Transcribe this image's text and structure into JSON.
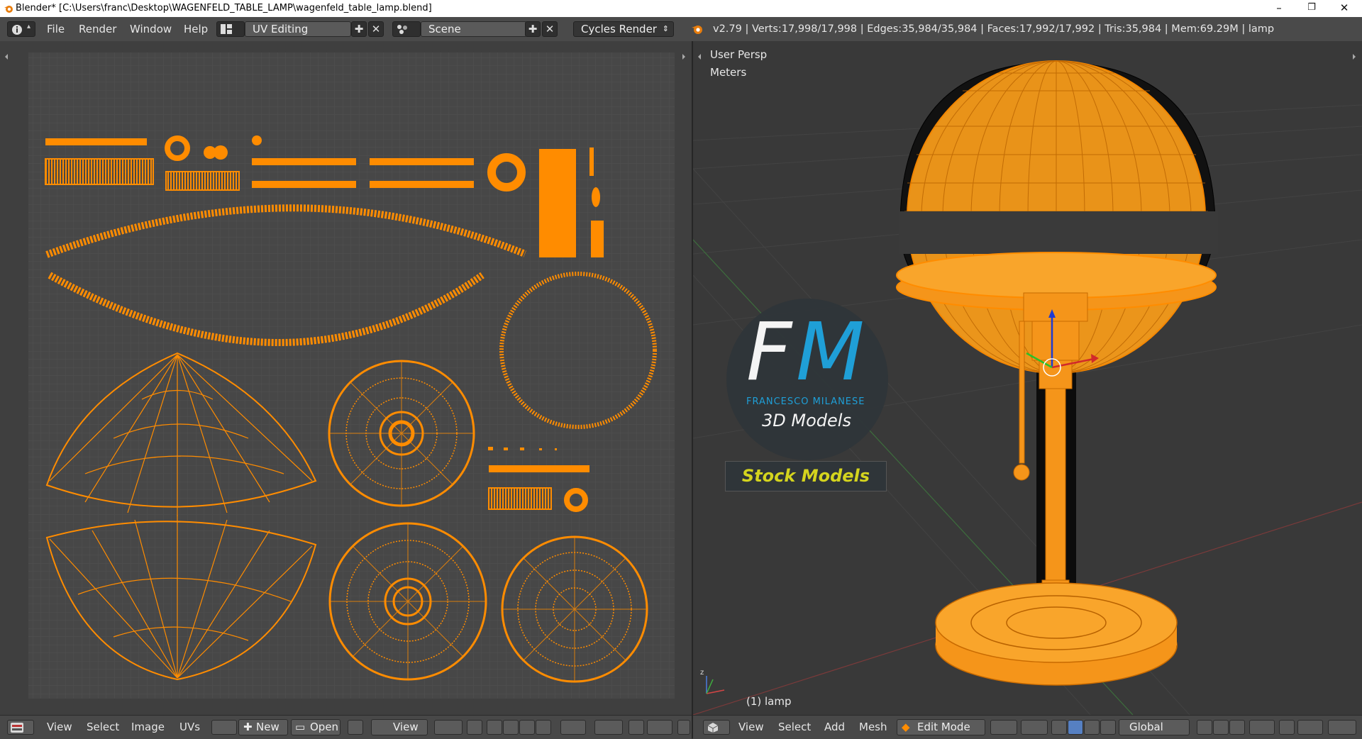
{
  "window": {
    "title": "Blender* [C:\\Users\\franc\\Desktop\\WAGENFELD_TABLE_LAMP\\wagenfeld_table_lamp.blend]",
    "minimize": "–",
    "restore": "❐",
    "close": "✕"
  },
  "topbar": {
    "menus": [
      "File",
      "Render",
      "Window",
      "Help"
    ],
    "screen_layout": "UV Editing",
    "scene": "Scene",
    "render_engine": "Cycles Render",
    "stats": "v2.79 | Verts:17,998/17,998 | Edges:35,984/35,984 | Faces:17,992/17,992 | Tris:35,984 | Mem:69.29M | lamp"
  },
  "viewport": {
    "view_name": "User Persp",
    "units": "Meters",
    "object_label": "(1) lamp",
    "logo": {
      "initials_f": "F",
      "initials_m": "M",
      "name": "FRANCESCO MILANESE",
      "subtitle": "3D Models",
      "banner": "Stock Models"
    }
  },
  "uv_footer": {
    "menus": [
      "View",
      "Select",
      "Image",
      "UVs"
    ],
    "new_label": "New",
    "open_label": "Open",
    "view_label": "View"
  },
  "vp_footer": {
    "menus": [
      "View",
      "Select",
      "Add",
      "Mesh"
    ],
    "mode": "Edit Mode",
    "orientation": "Global"
  },
  "colors": {
    "accent_orange": "#ff8c00",
    "logo_blue": "#1ea5e0",
    "logo_banner_text": "#d4d41e"
  },
  "icons": [
    "info-icon",
    "screen-layout-icon",
    "scene-icon",
    "blender-logo-icon",
    "image-editor-icon",
    "view3d-icon",
    "pin-icon"
  ]
}
